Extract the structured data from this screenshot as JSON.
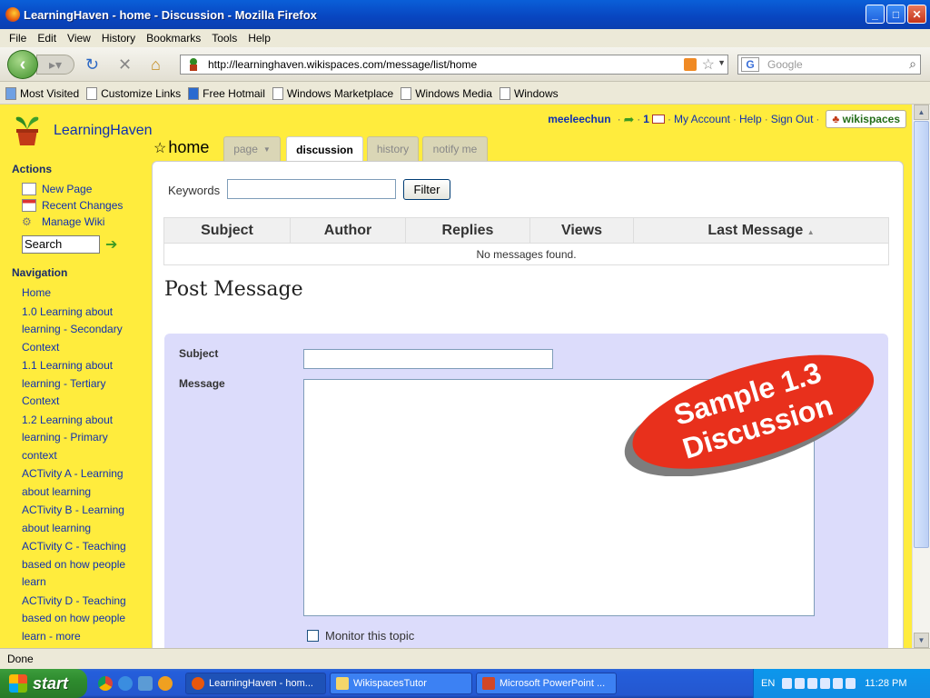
{
  "window": {
    "title": "LearningHaven - home - Discussion - Mozilla Firefox"
  },
  "menu": [
    "File",
    "Edit",
    "View",
    "History",
    "Bookmarks",
    "Tools",
    "Help"
  ],
  "address": {
    "url": "http://learninghaven.wikispaces.com/message/list/home",
    "search_placeholder": "Google"
  },
  "bookmarks": [
    "Most Visited",
    "Customize Links",
    "Free Hotmail",
    "Windows Marketplace",
    "Windows Media",
    "Windows"
  ],
  "site": {
    "name": "LearningHaven",
    "user": "meeleechun",
    "msg_count": "1",
    "links": [
      "My Account",
      "Help",
      "Sign Out"
    ],
    "wikispaces_label": "wikispaces"
  },
  "sidebar": {
    "actions_heading": "Actions",
    "actions": [
      "New Page",
      "Recent Changes",
      "Manage Wiki"
    ],
    "search_value": "Search",
    "nav_heading": "Navigation",
    "nav": [
      "Home",
      "1.0 Learning about learning - Secondary Context",
      "1.1 Learning about learning - Tertiary Context",
      "1.2 Learning about learning - Primary context",
      "ACTivity A - Learning about learning",
      "ACTivity B - Learning about learning",
      "ACTivity C - Teaching based on how people learn",
      "ACTivity D - Teaching based on how people learn - more"
    ]
  },
  "page": {
    "title": "home",
    "tabs": [
      "page",
      "discussion",
      "history",
      "notify me"
    ],
    "keywords_label": "Keywords",
    "filter_label": "Filter",
    "columns": [
      "Subject",
      "Author",
      "Replies",
      "Views",
      "Last Message"
    ],
    "empty_text": "No messages found.",
    "post_heading": "Post Message",
    "subject_label": "Subject",
    "message_label": "Message",
    "monitor_label": "Monitor this topic"
  },
  "stamp": {
    "line1": "Sample 1.3",
    "line2": "Discussion"
  },
  "status": {
    "text": "Done"
  },
  "taskbar": {
    "start": "start",
    "tasks": [
      "LearningHaven - hom...",
      "WikispacesTutor",
      "Microsoft PowerPoint ..."
    ],
    "lang": "EN",
    "clock": "11:28 PM"
  },
  "colors": {
    "page_bg": "#ffec3d",
    "link": "#1030b0",
    "stamp": "#e8301c"
  }
}
